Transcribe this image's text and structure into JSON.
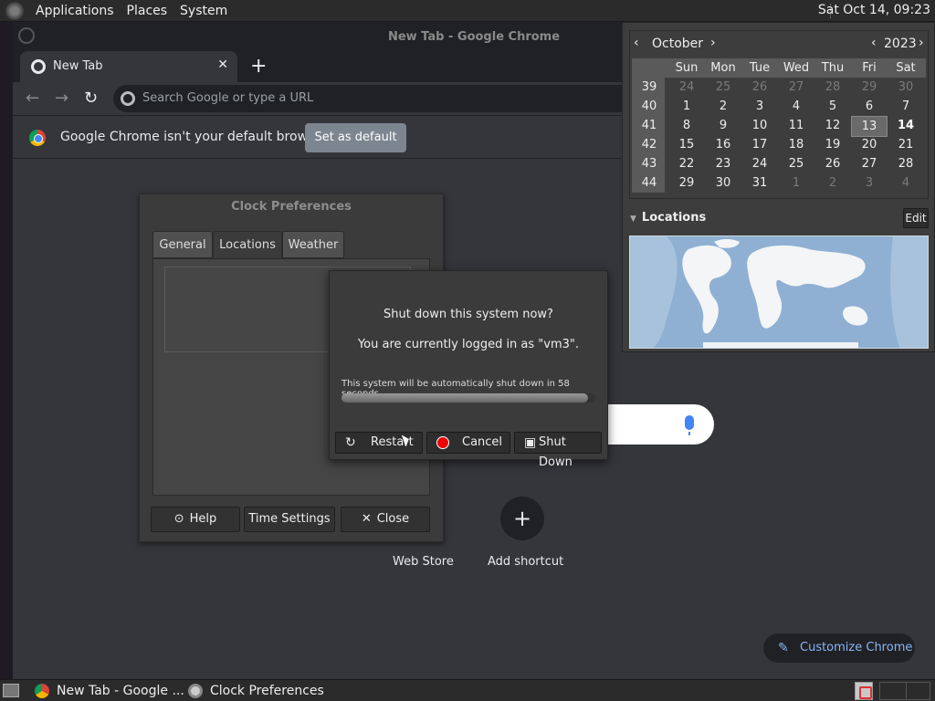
{
  "top_panel": {
    "menus": [
      "Applications",
      "Places",
      "System"
    ],
    "clock": "Sat Oct 14, 09:23"
  },
  "chrome": {
    "window_title": "New Tab - Google Chrome",
    "tab_label": "New Tab",
    "omnibox_placeholder": "Search Google or type a URL",
    "infobar_message": "Google Chrome isn't your default browser",
    "infobar_button": "Set as default",
    "shortcuts": [
      {
        "label": "Web Store"
      },
      {
        "label": "Add shortcut"
      }
    ],
    "customize_label": "Customize Chrome"
  },
  "clock_prefs": {
    "title": "Clock Preferences",
    "tabs": [
      "General",
      "Locations",
      "Weather"
    ],
    "active_tab": "Locations",
    "buttons": [
      "Help",
      "Time Settings",
      "Close"
    ]
  },
  "shutdown_dialog": {
    "question": "Shut down this system now?",
    "logged_in": "You are currently logged in as \"vm3\".",
    "timer_text": "This system will be automatically shut down in 58 seconds",
    "progress_fraction": 0.97,
    "buttons": [
      "Restart",
      "Cancel",
      "Shut Down"
    ]
  },
  "calendar": {
    "month": "October",
    "year": "2023",
    "weekdays": [
      "Sun",
      "Mon",
      "Tue",
      "Wed",
      "Thu",
      "Fri",
      "Sat"
    ],
    "weeks": [
      {
        "num": "39",
        "days": [
          "24",
          "25",
          "26",
          "27",
          "28",
          "29",
          "30"
        ],
        "dim": [
          true,
          true,
          true,
          true,
          true,
          true,
          true
        ]
      },
      {
        "num": "40",
        "days": [
          "1",
          "2",
          "3",
          "4",
          "5",
          "6",
          "7"
        ],
        "dim": [
          false,
          false,
          false,
          false,
          false,
          false,
          false
        ]
      },
      {
        "num": "41",
        "days": [
          "8",
          "9",
          "10",
          "11",
          "12",
          "13",
          "14"
        ],
        "dim": [
          false,
          false,
          false,
          false,
          false,
          false,
          false
        ]
      },
      {
        "num": "42",
        "days": [
          "15",
          "16",
          "17",
          "18",
          "19",
          "20",
          "21"
        ],
        "dim": [
          false,
          false,
          false,
          false,
          false,
          false,
          false
        ]
      },
      {
        "num": "43",
        "days": [
          "22",
          "23",
          "24",
          "25",
          "26",
          "27",
          "28"
        ],
        "dim": [
          false,
          false,
          false,
          false,
          false,
          false,
          false
        ]
      },
      {
        "num": "44",
        "days": [
          "29",
          "30",
          "31",
          "1",
          "2",
          "3",
          "4"
        ],
        "dim": [
          false,
          false,
          false,
          true,
          true,
          true,
          true
        ]
      }
    ],
    "selected_day": "13",
    "today": "14",
    "locations_label": "Locations",
    "edit_label": "Edit"
  },
  "taskbar": {
    "items": [
      "New Tab - Google ...",
      "Clock Preferences"
    ]
  }
}
